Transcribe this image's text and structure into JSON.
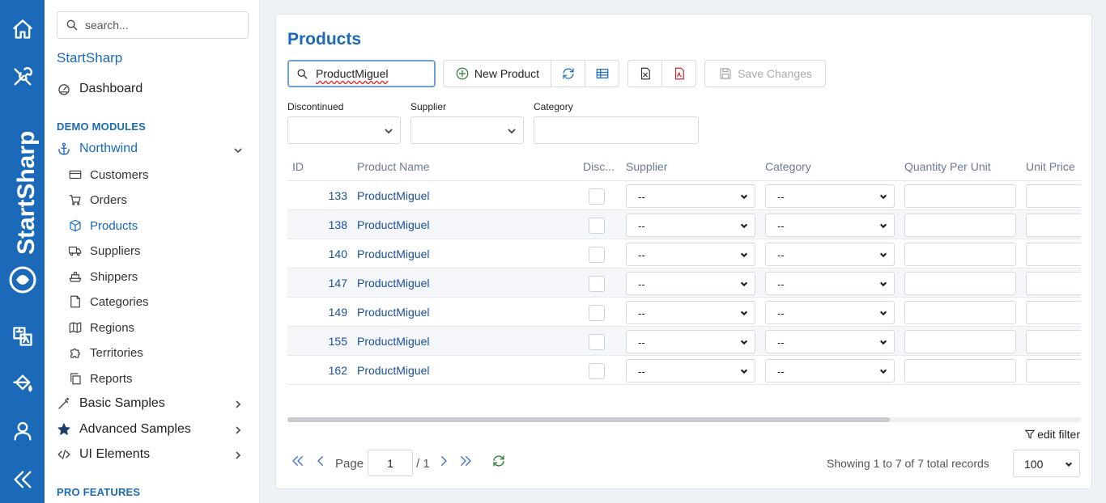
{
  "sidebar": {
    "search_placeholder": "search...",
    "brand": "StartSharp",
    "dashboard": "Dashboard",
    "section_demo": "DEMO MODULES",
    "northwind": "Northwind",
    "items": [
      {
        "label": "Customers",
        "icon": "card-icon"
      },
      {
        "label": "Orders",
        "icon": "cart-icon"
      },
      {
        "label": "Products",
        "icon": "box-icon"
      },
      {
        "label": "Suppliers",
        "icon": "truck-icon"
      },
      {
        "label": "Shippers",
        "icon": "ship-icon"
      },
      {
        "label": "Categories",
        "icon": "folder-icon"
      },
      {
        "label": "Regions",
        "icon": "map-icon"
      },
      {
        "label": "Territories",
        "icon": "puzzle-icon"
      },
      {
        "label": "Reports",
        "icon": "copy-icon"
      }
    ],
    "basic_samples": "Basic Samples",
    "advanced_samples": "Advanced Samples",
    "ui_elements": "UI Elements",
    "section_pro": "PRO FEATURES",
    "rail_brand": "StartSharp"
  },
  "main": {
    "title": "Products",
    "quick_search_value": "ProductMiguel",
    "toolbar": {
      "new_product": "New Product",
      "save_changes": "Save Changes"
    },
    "filters": {
      "discontinued_label": "Discontinued",
      "supplier_label": "Supplier",
      "category_label": "Category"
    },
    "columns": {
      "id": "ID",
      "product_name": "Product Name",
      "discontinued": "Disc...",
      "supplier": "Supplier",
      "category": "Category",
      "quantity_per_unit": "Quantity Per Unit",
      "unit_price": "Unit Price"
    },
    "rows": [
      {
        "id": "133",
        "name": "ProductMiguel",
        "supplier": "--",
        "category": "--"
      },
      {
        "id": "138",
        "name": "ProductMiguel",
        "supplier": "--",
        "category": "--"
      },
      {
        "id": "140",
        "name": "ProductMiguel",
        "supplier": "--",
        "category": "--"
      },
      {
        "id": "147",
        "name": "ProductMiguel",
        "supplier": "--",
        "category": "--"
      },
      {
        "id": "149",
        "name": "ProductMiguel",
        "supplier": "--",
        "category": "--"
      },
      {
        "id": "155",
        "name": "ProductMiguel",
        "supplier": "--",
        "category": "--"
      },
      {
        "id": "162",
        "name": "ProductMiguel",
        "supplier": "--",
        "category": "--"
      }
    ],
    "edit_filter": "edit filter",
    "pager": {
      "page_label": "Page",
      "page_value": "1",
      "page_total": "/ 1",
      "showing": "Showing 1 to 7 of 7 total records",
      "page_size": "100"
    }
  },
  "colors": {
    "accent": "#1a6ab9",
    "link": "#1a4f9e"
  }
}
